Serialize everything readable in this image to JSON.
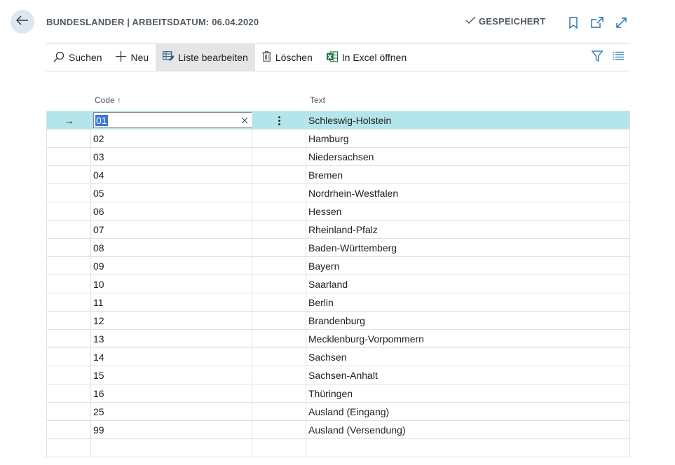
{
  "header": {
    "title": "BUNDESLANDER | ARBEITSDATUM: 06.04.2020",
    "saved_label": "GESPEICHERT",
    "icons": [
      "back-arrow-icon",
      "checkmark-icon",
      "bookmark-icon",
      "open-new-window-icon",
      "expand-icon"
    ]
  },
  "toolbar": {
    "search_label": "Suchen",
    "new_label": "Neu",
    "edit_list_label": "Liste bearbeiten",
    "delete_label": "Löschen",
    "excel_label": "In Excel öffnen",
    "icons": [
      "search-icon",
      "plus-icon",
      "edit-list-icon",
      "trash-icon",
      "excel-icon",
      "filter-icon",
      "list-view-icon"
    ]
  },
  "grid": {
    "columns": {
      "code": "Code",
      "code_sort": "↑",
      "text": "Text"
    },
    "selected_row_indicator": "→",
    "rows": [
      {
        "code": "01",
        "text": "Schleswig-Holstein"
      },
      {
        "code": "02",
        "text": "Hamburg"
      },
      {
        "code": "03",
        "text": "Niedersachsen"
      },
      {
        "code": "04",
        "text": "Bremen"
      },
      {
        "code": "05",
        "text": "Nordrhein-Westfalen"
      },
      {
        "code": "06",
        "text": "Hessen"
      },
      {
        "code": "07",
        "text": "Rheinland-Pfalz"
      },
      {
        "code": "08",
        "text": "Baden-Württemberg"
      },
      {
        "code": "09",
        "text": "Bayern"
      },
      {
        "code": "10",
        "text": "Saarland"
      },
      {
        "code": "11",
        "text": "Berlin"
      },
      {
        "code": "12",
        "text": "Brandenburg"
      },
      {
        "code": "13",
        "text": "Mecklenburg-Vorpommern"
      },
      {
        "code": "14",
        "text": "Sachsen"
      },
      {
        "code": "15",
        "text": "Sachsen-Anhalt"
      },
      {
        "code": "16",
        "text": "Thüringen"
      },
      {
        "code": "25",
        "text": "Ausland (Eingang)"
      },
      {
        "code": "99",
        "text": "Ausland (Versendung)"
      },
      {
        "code": "",
        "text": ""
      }
    ]
  },
  "colors": {
    "selected_row": "#b3e5ea",
    "back_button_bg": "#dce8ef",
    "excel_green": "#1e7145",
    "active_toolbar_bg": "#e5e5e5"
  }
}
